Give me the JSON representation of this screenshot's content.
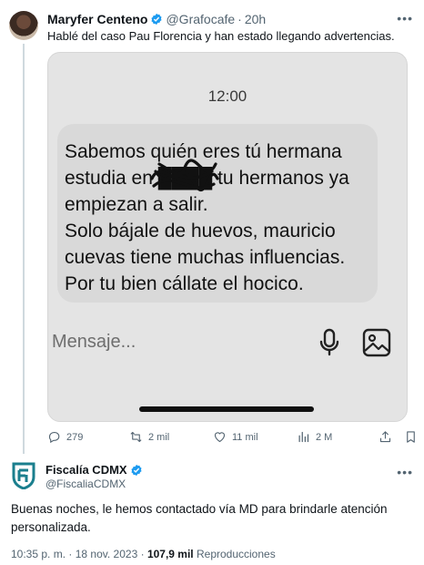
{
  "tweet1": {
    "author_name": "Maryfer Centeno",
    "handle": "@Grafocafe",
    "separator": "·",
    "time": "20h",
    "text": "Hablé del caso Pau Florencia y han estado llegando advertencias.",
    "more_icon": "more-horizontal-icon",
    "media": {
      "clock": "12:00",
      "message_lines": [
        "Sabemos quién eres tú hermana",
        "estudia en ████ tu hermanos ya",
        "empiezan a salir.",
        "Solo bájale de huevos, mauricio",
        "cuevas tiene muchas influencias.",
        "Por tu bien cállate el hocico."
      ],
      "composer_placeholder": "Mensaje...",
      "mic_icon": "microphone-icon",
      "gallery_icon": "image-gallery-icon"
    },
    "actions": {
      "replies": "279",
      "reposts": "2 mil",
      "likes": "11 mil",
      "views": "2 M"
    }
  },
  "tweet2": {
    "author_name": "Fiscalía CDMX",
    "handle": "@FiscaliaCDMX",
    "text": "Buenas noches, le hemos contactado vía MD para brindarle atención personalizada.",
    "time": "10:35 p. m.",
    "date": "18 nov. 2023",
    "views_count": "107,9 mil",
    "views_label": "Reproducciones"
  },
  "colors": {
    "verified_blue": "#1d9bf0",
    "fiscalia_teal": "#1b7f8e",
    "muted_text": "#536471"
  }
}
